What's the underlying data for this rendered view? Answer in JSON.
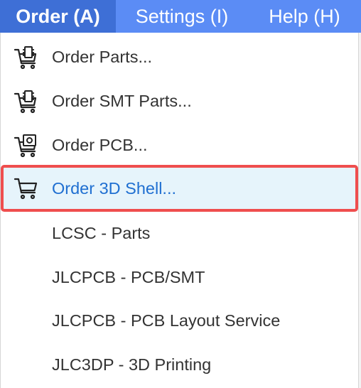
{
  "menubar": {
    "order": "Order (A)",
    "settings": "Settings (I)",
    "help": "Help (H)"
  },
  "menu": {
    "items": [
      {
        "label": "Order Parts...",
        "icon": "cart-chip-icon"
      },
      {
        "label": "Order SMT Parts...",
        "icon": "cart-smt-icon"
      },
      {
        "label": "Order PCB...",
        "icon": "cart-pcb-icon"
      },
      {
        "label": "Order 3D Shell...",
        "icon": "cart-icon",
        "highlighted": true
      },
      {
        "label": "LCSC - Parts"
      },
      {
        "label": "JLCPCB - PCB/SMT"
      },
      {
        "label": "JLCPCB - PCB Layout Service"
      },
      {
        "label": "JLC3DP - 3D Printing"
      }
    ]
  },
  "colors": {
    "menubar": "#5b8cf5",
    "menubar_active": "#3e6fd6",
    "highlight_bg": "#e6f4fb",
    "highlight_border": "#ef4e4e",
    "highlight_text": "#1f6fd1"
  }
}
